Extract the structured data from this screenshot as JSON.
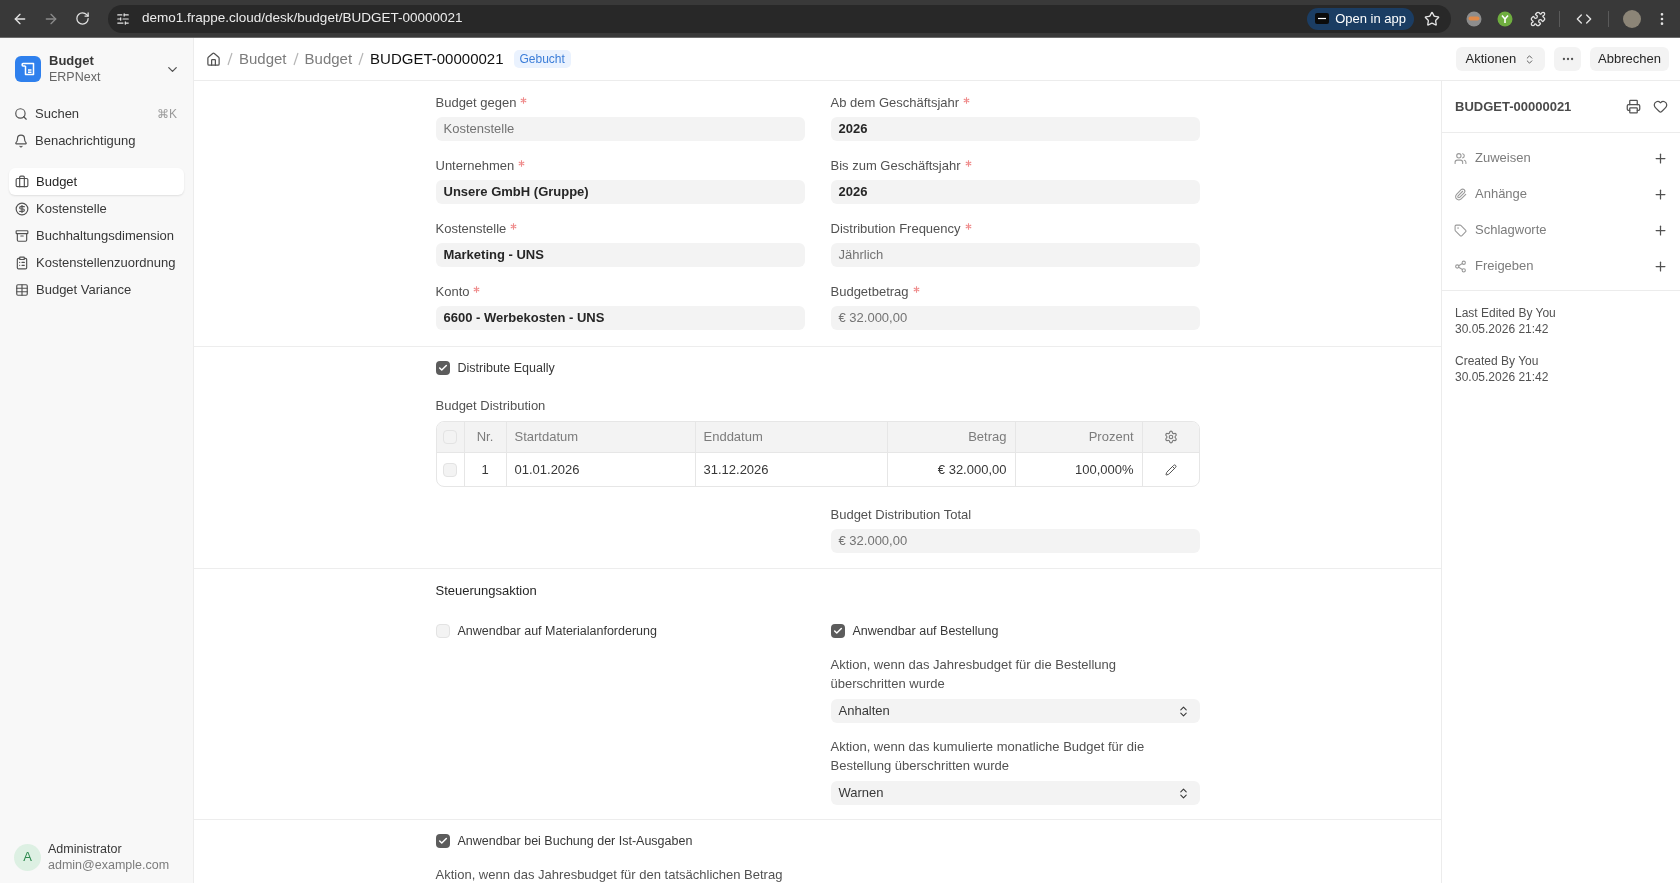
{
  "browser": {
    "url": "demo1.frappe.cloud/desk/budget/BUDGET-00000021",
    "open_in_app": "Open in app"
  },
  "sidebar": {
    "app": {
      "title": "Budget",
      "subtitle": "ERPNext"
    },
    "search": {
      "label": "Suchen",
      "shortcut": "⌘K"
    },
    "notifications": {
      "label": "Benachrichtigung"
    },
    "items": [
      {
        "label": "Budget",
        "selected": true
      },
      {
        "label": "Kostenstelle",
        "selected": false
      },
      {
        "label": "Buchhaltungsdimension",
        "selected": false
      },
      {
        "label": "Kostenstellenzuordnung",
        "selected": false
      },
      {
        "label": "Budget Variance",
        "selected": false
      }
    ],
    "user": {
      "initial": "A",
      "name": "Administrator",
      "email": "admin@example.com"
    }
  },
  "header": {
    "breadcrumbs": [
      "Budget",
      "Budget"
    ],
    "title": "BUDGET-00000021",
    "status": "Gebucht",
    "buttons": [
      {
        "kind": "dropdown",
        "label": "Aktionen"
      },
      {
        "kind": "more"
      },
      {
        "kind": "plain",
        "label": "Abbrechen"
      }
    ]
  },
  "form": {
    "columns": [
      [
        {
          "label": "Budget gegen",
          "required": true,
          "value": "Kostenstelle",
          "emphasized": false
        },
        {
          "label": "Unternehmen",
          "required": true,
          "value": "Unsere GmbH (Gruppe)",
          "emphasized": true
        },
        {
          "label": "Kostenstelle",
          "required": true,
          "value": "Marketing - UNS",
          "emphasized": true
        },
        {
          "label": "Konto",
          "required": true,
          "value": "6600 - Werbekosten - UNS",
          "emphasized": true
        }
      ],
      [
        {
          "label": "Ab dem Geschäftsjahr",
          "required": true,
          "value": "2026",
          "emphasized": true
        },
        {
          "label": "Bis zum Geschäftsjahr",
          "required": true,
          "value": "2026",
          "emphasized": true
        },
        {
          "label": "Distribution Frequency",
          "required": true,
          "value": "Jährlich",
          "emphasized": false
        },
        {
          "label": "Budgetbetrag",
          "required": true,
          "value": "€ 32.000,00",
          "emphasized": false
        }
      ]
    ]
  },
  "distribute_equally": {
    "label": "Distribute Equally",
    "checked": true
  },
  "budget_distribution": {
    "label": "Budget Distribution",
    "all_selected": false,
    "columns": [
      "Nr.",
      "Startdatum",
      "Enddatum",
      "Betrag",
      "Prozent"
    ],
    "rows": [
      {
        "selected": false,
        "cells": [
          "1",
          "01.01.2026",
          "31.12.2026",
          "€ 32.000,00",
          "100,000%"
        ]
      }
    ]
  },
  "distribution_total": {
    "label": "Budget Distribution Total",
    "value": "€ 32.000,00",
    "emphasized": false
  },
  "control_action": {
    "title": "Steuerungsaktion",
    "material_request": {
      "label": "Anwendbar auf Materialanforderung",
      "checked": false
    },
    "purchase_order": {
      "label": "Anwendbar auf Bestellung",
      "checked": true,
      "actions": [
        {
          "label": "Aktion, wenn das Jahresbudget für die Bestellung überschritten wurde",
          "value": "Anhalten"
        },
        {
          "label": "Aktion, wenn das kumulierte monatliche Budget für die Bestellung überschritten wurde",
          "value": "Warnen"
        }
      ]
    }
  },
  "actual_expenses": {
    "label": "Anwendbar bei Buchung der Ist-Ausgaben",
    "checked": true,
    "action_label": "Aktion, wenn das Jahresbudget für den tatsächlichen Betrag"
  },
  "side_panel": {
    "title": "BUDGET-00000021",
    "actions": [
      {
        "label": "Zuweisen"
      },
      {
        "label": "Anhänge"
      },
      {
        "label": "Schlagworte"
      },
      {
        "label": "Freigeben"
      }
    ],
    "activity": [
      {
        "label": "Last Edited By You",
        "time": "30.05.2026 21:42"
      },
      {
        "label": "Created By You",
        "time": "30.05.2026 21:42"
      }
    ]
  }
}
